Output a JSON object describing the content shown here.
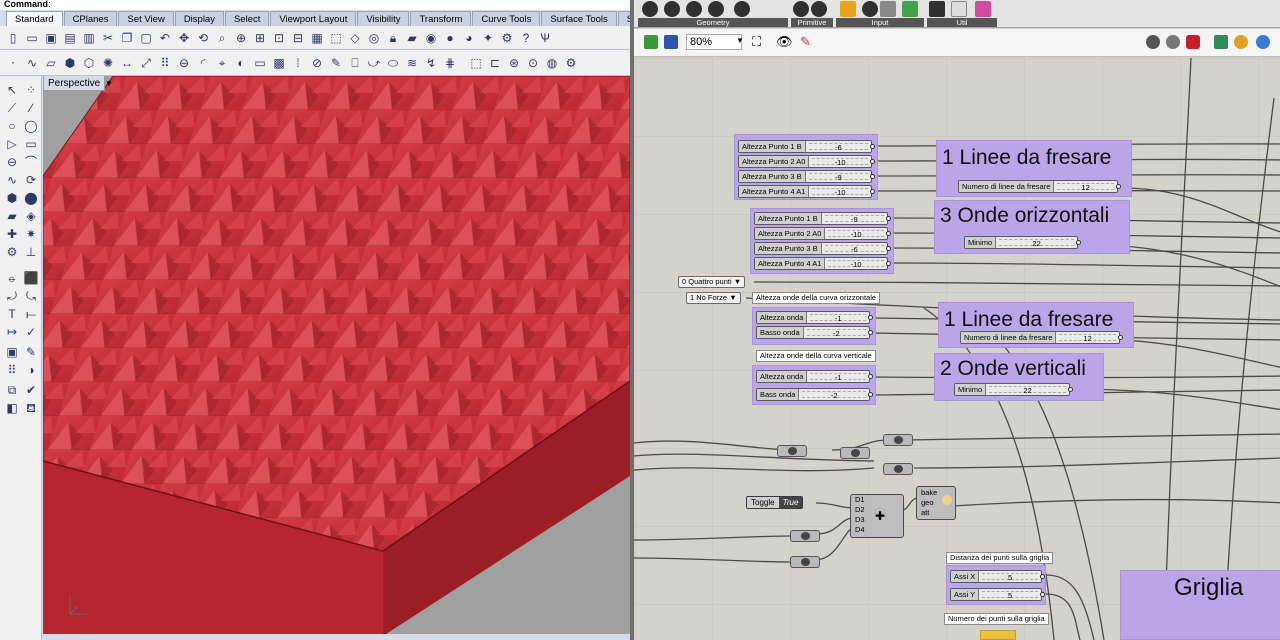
{
  "rhino": {
    "command_label": "Command:",
    "tabs": [
      "Standard",
      "CPlanes",
      "Set View",
      "Display",
      "Select",
      "Viewport Layout",
      "Visibility",
      "Transform",
      "Curve Tools",
      "Surface Tools",
      "Solid Tools"
    ],
    "active_tab": "Standard",
    "viewport": {
      "title": "Perspective"
    },
    "model_color": "#c8323a"
  },
  "gh": {
    "tab_groups": [
      "Geometry",
      "Primitive",
      "Input",
      "Util"
    ],
    "zoom": "80%",
    "groups": {
      "g1": {
        "title": "1 Linee da fresare",
        "slider_label": "Numero di linee da fresare",
        "slider_value": "12"
      },
      "g2": {
        "title": "3 Onde orizzontali",
        "slider_label": "Minimo",
        "slider_value": "22"
      },
      "g3": {
        "title": "1 Linee da fresare",
        "slider_label": "Numero di linee da fresare",
        "slider_value": "12"
      },
      "g4": {
        "title": "2 Onde verticali",
        "slider_label": "Minimo",
        "slider_value": "22"
      },
      "g5": {
        "title": "Griglia"
      }
    },
    "sliders_a": [
      {
        "label": "Altezza Punto 1 B",
        "value": "-6"
      },
      {
        "label": "Altezza Punto 2 A0",
        "value": "-10"
      },
      {
        "label": "Altezza Punto 3 B",
        "value": "-9"
      },
      {
        "label": "Altezza Punto 4 A1",
        "value": "-10"
      }
    ],
    "sliders_b": [
      {
        "label": "Altezza Punto 1 B",
        "value": "-9"
      },
      {
        "label": "Altezza Punto 2 A0",
        "value": "-10"
      },
      {
        "label": "Altezza Punto 3 B",
        "value": "-6"
      },
      {
        "label": "Altezza Punto 4 A1",
        "value": "-10"
      }
    ],
    "value_list_1": "0 Quattro punti",
    "value_list_2": "1 No Forze",
    "panel_h": "Altezza onde della curva orizzontale",
    "sliders_h": [
      {
        "label": "Altezza onda",
        "value": "-1"
      },
      {
        "label": "Basso onda",
        "value": "-2"
      }
    ],
    "panel_v": "Altezza onde della curva verticale",
    "sliders_v": [
      {
        "label": "Altezza onda",
        "value": "-1"
      },
      {
        "label": "Bass onda",
        "value": "-2"
      }
    ],
    "toggle": {
      "label": "Toggle",
      "value": "True"
    },
    "merge_inputs": [
      "D1",
      "D2",
      "D3",
      "D4"
    ],
    "bake_inputs": [
      "bake",
      "geo",
      "att"
    ],
    "panel_dist": "Distanza dei punti sulla griglia",
    "sliders_grid": [
      {
        "label": "Assi X",
        "value": "5"
      },
      {
        "label": "Assi Y",
        "value": "5"
      }
    ],
    "panel_num": "Numero dei punti sulla griglia"
  }
}
